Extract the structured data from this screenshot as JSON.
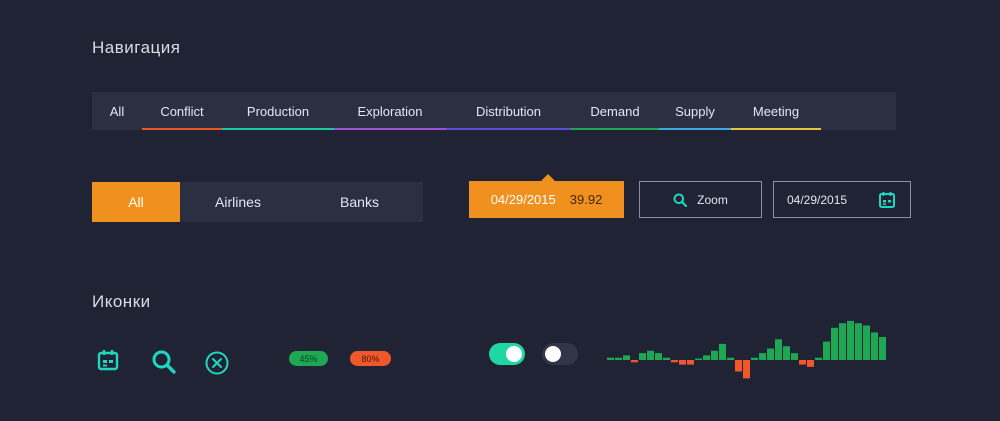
{
  "sections": {
    "navigation_title": "Навигация",
    "icons_title": "Иконки"
  },
  "navbar": {
    "tabs": [
      {
        "label": "All",
        "color": ""
      },
      {
        "label": "Conflict",
        "color": "#e8552a"
      },
      {
        "label": "Production",
        "color": "#1fc9a0"
      },
      {
        "label": "Exploration",
        "color": "#a14fd6"
      },
      {
        "label": "Distribution",
        "color": "#5a4fd6"
      },
      {
        "label": "Demand",
        "color": "#1fa853"
      },
      {
        "label": "Supply",
        "color": "#3ea8e0"
      },
      {
        "label": "Meeting",
        "color": "#e8c23a"
      }
    ]
  },
  "segmented": {
    "items": [
      {
        "label": "All",
        "active": true
      },
      {
        "label": "Airlines",
        "active": false
      },
      {
        "label": "Banks",
        "active": false
      }
    ]
  },
  "tooltip": {
    "date": "04/29/2015",
    "value": "39.92"
  },
  "zoom_button": {
    "label": "Zoom",
    "icon": "search-icon"
  },
  "date_field": {
    "value": "04/29/2015",
    "icon": "calendar-icon"
  },
  "icons_row": {
    "icons": [
      "calendar-icon",
      "search-icon",
      "close-circle-icon"
    ],
    "badges": [
      {
        "label": "45%",
        "color": "#1fa853"
      },
      {
        "label": "80%",
        "color": "#f0572a"
      }
    ],
    "toggles": [
      {
        "state": "on",
        "color": "#1fd6a4"
      },
      {
        "state": "off",
        "color": "#31354a"
      }
    ]
  },
  "colors": {
    "background": "#202334",
    "panel": "#2b2f42",
    "accent": "#f0901e",
    "teal": "#1fd6c0",
    "positive": "#1fa853",
    "negative": "#f0572a"
  },
  "chart_data": {
    "type": "bar",
    "values": [
      1,
      1,
      2,
      -1,
      3,
      4,
      3,
      1,
      -1,
      -2,
      -2,
      0,
      2,
      4,
      7,
      1,
      -5,
      -8,
      1,
      3,
      5,
      9,
      6,
      3,
      -2,
      -3,
      1,
      8,
      14,
      16,
      17,
      16,
      15,
      12,
      10
    ],
    "positive_color": "#1fa853",
    "negative_color": "#f0572a"
  }
}
